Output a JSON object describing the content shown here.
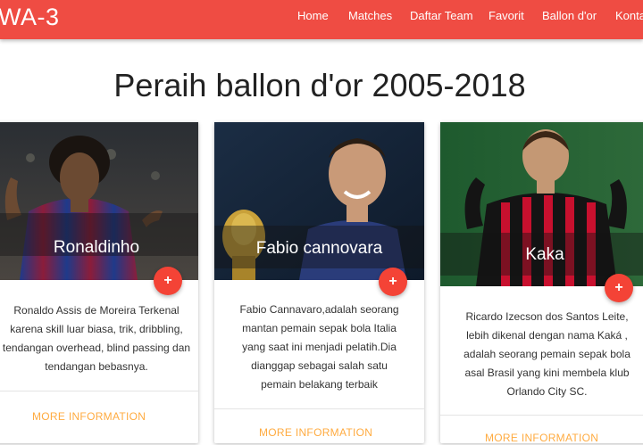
{
  "navbar": {
    "brand": "WA-3",
    "links": [
      "Home",
      "Matches",
      "Daftar Team",
      "Favorit",
      "Ballon d'or",
      "Kontak"
    ]
  },
  "page_title": "Peraih ballon d'or 2005-2018",
  "cards": [
    {
      "name": "Ronaldinho",
      "description": "Ronaldo Assis de Moreira Terkenal karena skill luar biasa, trik, dribbling, tendangan overhead, blind passing dan tendangan bebasnya.",
      "link": "MORE INFORMATION",
      "fab": "+"
    },
    {
      "name": "Fabio cannovara",
      "description": "Fabio Cannavaro,adalah seorang mantan pemain sepak bola Italia yang saat ini menjadi pelatih.Dia dianggap sebagai salah satu pemain belakang terbaik",
      "link": "MORE INFORMATION",
      "fab": "+"
    },
    {
      "name": "Kaka",
      "description": "Ricardo Izecson dos Santos Leite, lebih dikenal dengan nama Kaká , adalah seorang pemain sepak bola asal Brasil yang kini membela klub Orlando City SC.",
      "link": "MORE INFORMATION",
      "fab": "+"
    }
  ],
  "colors": {
    "navbar": "#ef4c43",
    "fab": "#f44336",
    "link": "#ffab40"
  }
}
